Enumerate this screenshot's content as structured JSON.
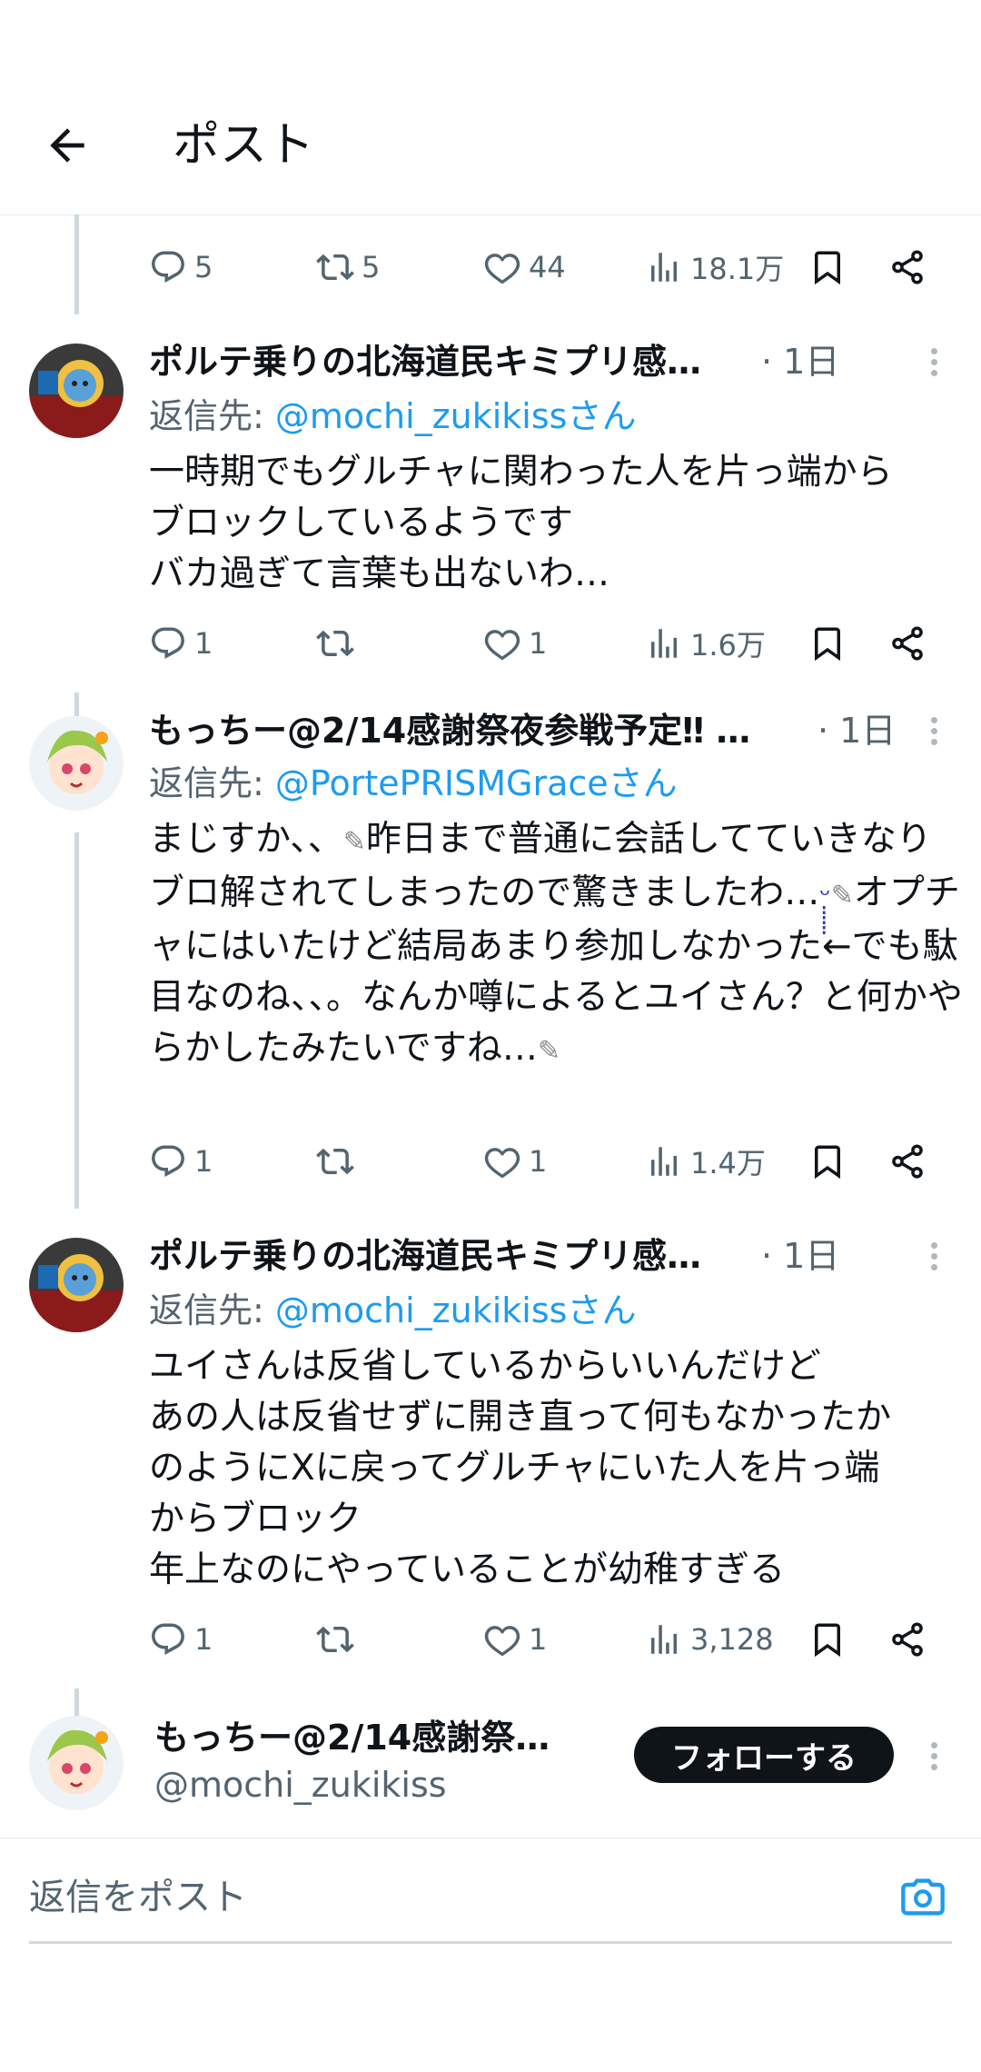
{
  "header": {
    "title": "ポスト"
  },
  "top_actions": {
    "replies": "5",
    "reposts": "5",
    "likes": "44",
    "views": "18.1万"
  },
  "posts": [
    {
      "name": "ポルテ乗りの北海道民キミプリ感…",
      "time": "· 1日",
      "reply_label": "返信先: ",
      "reply_handle": "@mochi_zukikissさん",
      "lines": [
        "一時期でもグルチャに関わった人を片っ端から",
        "ブロックしているようです",
        "バカ過ぎて言葉も出ないわ…"
      ],
      "replies": "1",
      "reposts": "",
      "likes": "1",
      "views": "1.6万"
    },
    {
      "name": "もっちー@2/14感謝祭夜参戦予定‼ …",
      "time": "· 1日",
      "reply_label": "返信先: ",
      "reply_handle": "@PortePRISMGraceさん",
      "lines": [
        "まじすか、、",
        "昨日まで普通に会話してていきなりブロ解されてしまったので驚きましたわ…",
        "オプチャにはいたけど結局あまり参加しなかった←でも駄目なのね、、。なんか噂によるとユイさん？と何かやらかしたみたいですね…"
      ],
      "replies": "1",
      "reposts": "",
      "likes": "1",
      "views": "1.4万"
    },
    {
      "name": "ポルテ乗りの北海道民キミプリ感…",
      "time": "· 1日",
      "reply_label": "返信先: ",
      "reply_handle": "@mochi_zukikissさん",
      "lines": [
        "ユイさんは反省しているからいいんだけど",
        "あの人は反省せずに開き直って何もなかったか",
        "のようにXに戻ってグルチャにいた人を片っ端",
        "からブロック",
        "年上なのにやっていることが幼稚すぎる"
      ],
      "replies": "1",
      "reposts": "",
      "likes": "1",
      "views": "3,128"
    }
  ],
  "follow_card": {
    "name": "もっちー@2/14感謝祭…",
    "handle": "@mochi_zukikiss",
    "follow_label": "フォローする"
  },
  "compose": {
    "placeholder": "返信をポスト"
  },
  "icons": {
    "back": "arrow-left-icon",
    "reply": "reply-bubble-icon",
    "repost": "repost-icon",
    "like": "heart-icon",
    "views": "bar-chart-icon",
    "bookmark": "bookmark-icon",
    "share": "share-icon",
    "more": "more-vertical-icon",
    "camera": "camera-icon"
  },
  "colors": {
    "accent": "#1d9bf0",
    "text": "#0f1419",
    "secondary": "#536471",
    "thread_line": "#cfd9de"
  }
}
